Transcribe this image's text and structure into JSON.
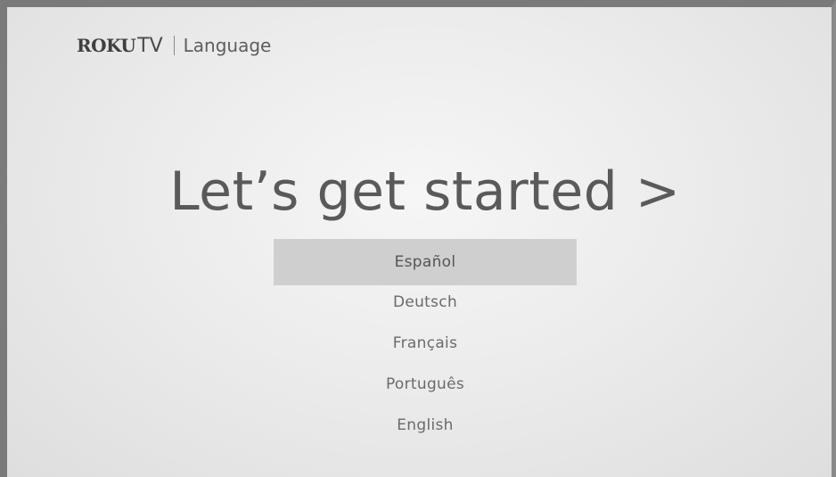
{
  "header": {
    "brand_roku": "ROKU",
    "brand_tv": "TV",
    "section_title": "Language"
  },
  "headline": "Let’s get started >",
  "languages": [
    {
      "label": "Español",
      "selected": true
    },
    {
      "label": "Deutsch",
      "selected": false
    },
    {
      "label": "Français",
      "selected": false
    },
    {
      "label": "Português",
      "selected": false
    },
    {
      "label": "English",
      "selected": false
    }
  ],
  "colors": {
    "background": "#ececec",
    "selection_highlight": "#cfcfcf",
    "text": "#5a5a5a",
    "frame_border": "#7a7a7a"
  }
}
